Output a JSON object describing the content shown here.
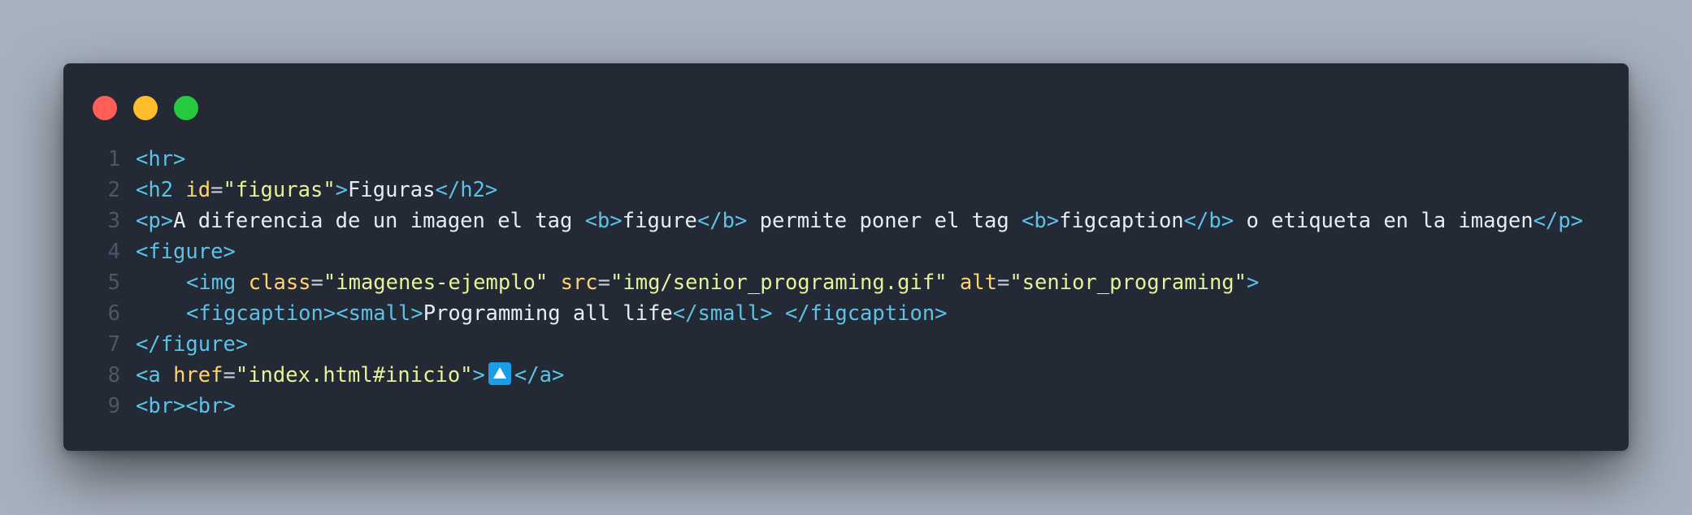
{
  "window": {
    "controls": [
      "close",
      "minimize",
      "maximize"
    ],
    "colors": {
      "close": "#ff5f56",
      "minimize": "#ffbd2e",
      "maximize": "#27c93f",
      "background": "#232935",
      "tag": "#5cc2e6",
      "attribute": "#ffd56b",
      "string": "#e7f197"
    }
  },
  "lines": [
    {
      "num": "1",
      "parts": [
        {
          "t": "tag",
          "v": "<hr>"
        }
      ]
    },
    {
      "num": "2",
      "parts": [
        {
          "t": "tag",
          "v": "<h2 "
        },
        {
          "t": "attr",
          "v": "id"
        },
        {
          "t": "punc",
          "v": "="
        },
        {
          "t": "str",
          "v": "\"figuras\""
        },
        {
          "t": "tag",
          "v": ">"
        },
        {
          "t": "txt",
          "v": "Figuras"
        },
        {
          "t": "tag",
          "v": "</h2>"
        }
      ]
    },
    {
      "num": "3",
      "parts": [
        {
          "t": "tag",
          "v": "<p>"
        },
        {
          "t": "txt",
          "v": "A diferencia de un imagen el tag "
        },
        {
          "t": "tag",
          "v": "<b>"
        },
        {
          "t": "txt",
          "v": "figure"
        },
        {
          "t": "tag",
          "v": "</b>"
        },
        {
          "t": "txt",
          "v": " permite poner el tag "
        },
        {
          "t": "tag",
          "v": "<b>"
        },
        {
          "t": "txt",
          "v": "figcaption"
        },
        {
          "t": "tag",
          "v": "</b>"
        },
        {
          "t": "txt",
          "v": " o etiqueta en la imagen"
        },
        {
          "t": "tag",
          "v": "</p>"
        }
      ]
    },
    {
      "num": "4",
      "parts": [
        {
          "t": "tag",
          "v": "<figure>"
        }
      ]
    },
    {
      "num": "5",
      "indent": true,
      "parts": [
        {
          "t": "tag",
          "v": "<img "
        },
        {
          "t": "attr",
          "v": "class"
        },
        {
          "t": "punc",
          "v": "="
        },
        {
          "t": "str",
          "v": "\"imagenes-ejemplo\""
        },
        {
          "t": "txt",
          "v": " "
        },
        {
          "t": "attr",
          "v": "src"
        },
        {
          "t": "punc",
          "v": "="
        },
        {
          "t": "str",
          "v": "\"img/senior_programing.gif\""
        },
        {
          "t": "txt",
          "v": " "
        },
        {
          "t": "attr",
          "v": "alt"
        },
        {
          "t": "punc",
          "v": "="
        },
        {
          "t": "str",
          "v": "\"senior_programing\""
        },
        {
          "t": "tag",
          "v": ">"
        }
      ]
    },
    {
      "num": "6",
      "indent": true,
      "parts": [
        {
          "t": "tag",
          "v": "<figcaption><small>"
        },
        {
          "t": "txt",
          "v": "Programming all life"
        },
        {
          "t": "tag",
          "v": "</small>"
        },
        {
          "t": "txt",
          "v": " "
        },
        {
          "t": "tag",
          "v": "</figcaption>"
        }
      ]
    },
    {
      "num": "7",
      "parts": [
        {
          "t": "tag",
          "v": "</figure>"
        }
      ]
    },
    {
      "num": "8",
      "parts": [
        {
          "t": "tag",
          "v": "<a "
        },
        {
          "t": "attr",
          "v": "href"
        },
        {
          "t": "punc",
          "v": "="
        },
        {
          "t": "str",
          "v": "\"index.html#inicio\""
        },
        {
          "t": "tag",
          "v": ">"
        },
        {
          "t": "emoji",
          "v": "up-arrow-button-icon"
        },
        {
          "t": "tag",
          "v": "</a>"
        }
      ]
    },
    {
      "num": "9",
      "parts": [
        {
          "t": "tag",
          "v": "<br><br>"
        }
      ]
    }
  ]
}
